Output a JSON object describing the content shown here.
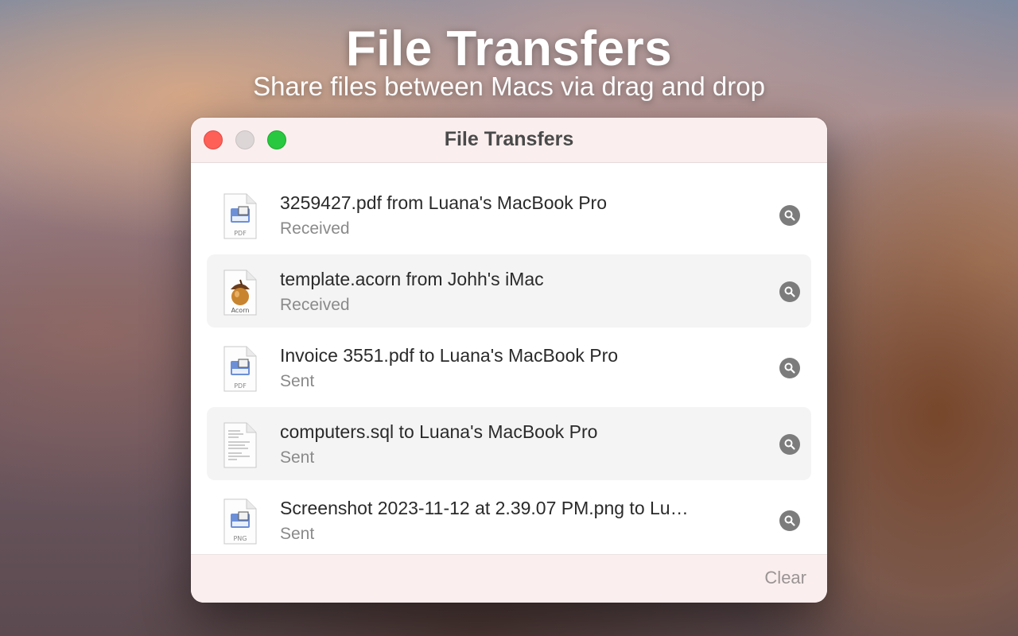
{
  "hero": {
    "title": "File Transfers",
    "subtitle": "Share files between Macs via drag and drop"
  },
  "window": {
    "title": "File Transfers",
    "clear_label": "Clear"
  },
  "transfers": [
    {
      "name": "3259427.pdf from Luana's MacBook Pro",
      "status": "Received",
      "icon": "pdf-file-icon",
      "icon_label": "PDF"
    },
    {
      "name": "template.acorn from Johh's iMac",
      "status": "Received",
      "icon": "acorn-file-icon",
      "icon_label": "Acorn"
    },
    {
      "name": "Invoice 3551.pdf to Luana's MacBook Pro",
      "status": "Sent",
      "icon": "pdf-file-icon",
      "icon_label": "PDF"
    },
    {
      "name": "computers.sql to Luana's MacBook Pro",
      "status": "Sent",
      "icon": "text-file-icon",
      "icon_label": ""
    },
    {
      "name": "Screenshot 2023-11-12 at 2.39.07 PM.png to Luana'...",
      "status": "Sent",
      "icon": "png-file-icon",
      "icon_label": "PNG"
    }
  ],
  "colors": {
    "close": "#fe5f57",
    "minimize": "#dcd6d6",
    "zoom": "#28c840",
    "titlebar": "#fbeeee"
  }
}
